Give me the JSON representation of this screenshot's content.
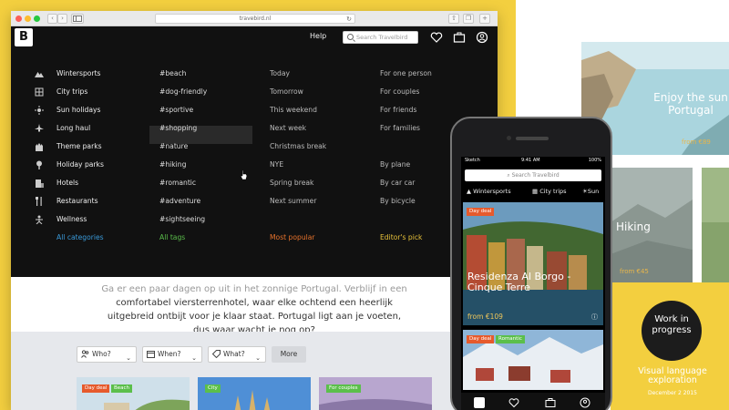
{
  "browser": {
    "url": "travebird.nl",
    "nav_back": "‹",
    "nav_forward": "›"
  },
  "header": {
    "logo_letter": "B",
    "help": "Help",
    "search_placeholder": "Search Travelbird"
  },
  "menu": {
    "categories": [
      {
        "label": "Wintersports",
        "icon": "mountain-icon"
      },
      {
        "label": "City trips",
        "icon": "city-icon"
      },
      {
        "label": "Sun holidays",
        "icon": "sun-icon"
      },
      {
        "label": "Long haul",
        "icon": "plane-icon"
      },
      {
        "label": "Theme parks",
        "icon": "castle-icon"
      },
      {
        "label": "Holiday parks",
        "icon": "tree-icon"
      },
      {
        "label": "Hotels",
        "icon": "hotel-icon"
      },
      {
        "label": "Restaurants",
        "icon": "cutlery-icon"
      },
      {
        "label": "Wellness",
        "icon": "wellness-icon"
      }
    ],
    "all_categories": "All categories",
    "tags": [
      "#beach",
      "#dog-friendly",
      "#sportive",
      "#shopping",
      "#nature",
      "#hiking",
      "#romantic",
      "#adventure",
      "#sightseeing"
    ],
    "all_tags": "All tags",
    "when": [
      "Today",
      "Tomorrow",
      "This weekend",
      "Next week",
      "Christmas break",
      "NYE",
      "Spring break",
      "Next summer"
    ],
    "most_popular": "Most popular",
    "who": [
      "For one person",
      "For couples",
      "For friends",
      "For families"
    ],
    "how": [
      "By plane",
      "By car car",
      "By bicycle"
    ],
    "editors_pick": "Editor's pick",
    "accent_colors": {
      "blue": "#3a9ad9",
      "green": "#5bbf4b",
      "orange": "#e8732c",
      "yellow": "#e8c23a"
    }
  },
  "content": {
    "line0": "Ga er een paar dagen op uit in het zonnige Portugal. Verblijf in een",
    "line1": "comfortabel viersterrenhotel, waar elke ochtend een heerlijk",
    "line2": "uitgebreid ontbijt voor je klaar staat. Portugal ligt aan je voeten,",
    "line3": "dus waar wacht je nog op?"
  },
  "filters": {
    "who": "Who?",
    "when": "When?",
    "what": "What?",
    "more": "More"
  },
  "cards": [
    {
      "badges": [
        "Day deal",
        "Beach"
      ]
    },
    {
      "badges": [
        "City"
      ]
    },
    {
      "badges": [
        "For couples"
      ]
    }
  ],
  "phone": {
    "carrier": "Sketch",
    "time": "9:41 AM",
    "battery": "100%",
    "search_placeholder": "Search Travelbird",
    "cats": [
      "Wintersports",
      "City trips",
      "Sun"
    ],
    "card1": {
      "badge": "Day deal",
      "title": "Residenza Al Borgo - Cinque Terre",
      "price": "from €109"
    },
    "card2": {
      "badges": [
        "Day deal",
        "Romantic"
      ]
    }
  },
  "showcase": {
    "portugal_title": "Enjoy the sun Portugal",
    "portugal_price": "from €89",
    "hiking_title": "Hiking",
    "hiking_price": "from €45",
    "wip": "Work in progress",
    "visual_language": "Visual language exploration",
    "date": "December 2 2015"
  }
}
